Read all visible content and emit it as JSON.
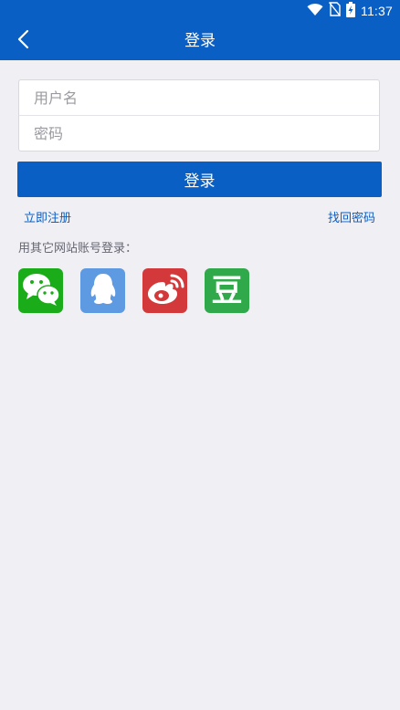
{
  "status_bar": {
    "time": "11:37",
    "icons": [
      "wifi-icon",
      "no-sim-icon",
      "battery-charging-icon"
    ]
  },
  "nav": {
    "title": "登录",
    "back_icon": "chevron-left-icon"
  },
  "form": {
    "username_placeholder": "用户名",
    "password_placeholder": "密码",
    "username_value": "",
    "password_value": ""
  },
  "actions": {
    "login_label": "登录",
    "register_label": "立即注册",
    "forgot_label": "找回密码"
  },
  "social": {
    "label": "用其它网站账号登录：",
    "items": [
      {
        "name": "wechat",
        "icon": "wechat-icon",
        "color": "#1aad19"
      },
      {
        "name": "qq",
        "icon": "qq-icon",
        "color": "#5d9ae2"
      },
      {
        "name": "weibo",
        "icon": "weibo-icon",
        "color": "#d3393a"
      },
      {
        "name": "douban",
        "icon": "douban-icon",
        "color": "#2fa94a",
        "glyph": "豆"
      }
    ]
  },
  "colors": {
    "primary": "#0a5fc4",
    "background": "#efeff4"
  }
}
